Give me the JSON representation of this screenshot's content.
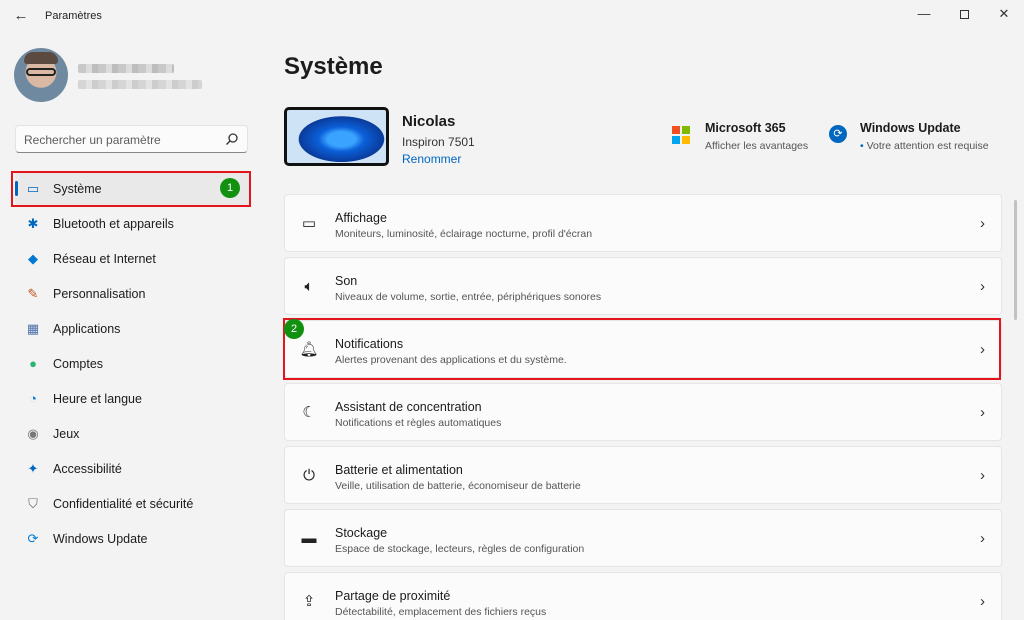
{
  "window": {
    "title": "Paramètres",
    "back_glyph": "←",
    "minimize_glyph": "—",
    "close_glyph": "✕"
  },
  "search": {
    "placeholder": "Rechercher un paramètre"
  },
  "sidebar": {
    "items": [
      {
        "label": "Système",
        "icon": "monitor-icon",
        "glyph": "▭",
        "color": "#0067c0",
        "active": true
      },
      {
        "label": "Bluetooth et appareils",
        "icon": "bluetooth-icon",
        "glyph": "✱",
        "color": "#0067c0"
      },
      {
        "label": "Réseau et Internet",
        "icon": "wifi-icon",
        "glyph": "◆",
        "color": "#0078d4"
      },
      {
        "label": "Personnalisation",
        "icon": "brush-icon",
        "glyph": "✎",
        "color": "#c24f1a"
      },
      {
        "label": "Applications",
        "icon": "apps-icon",
        "glyph": "▦",
        "color": "#4b6ea8"
      },
      {
        "label": "Comptes",
        "icon": "person-icon",
        "glyph": "●",
        "color": "#2bb673"
      },
      {
        "label": "Heure et langue",
        "icon": "globe-clock-icon",
        "glyph": "◔",
        "color": "#0078d4"
      },
      {
        "label": "Jeux",
        "icon": "gamepad-icon",
        "glyph": "◉",
        "color": "#777777"
      },
      {
        "label": "Accessibilité",
        "icon": "accessibility-icon",
        "glyph": "✦",
        "color": "#0067c0"
      },
      {
        "label": "Confidentialité et sécurité",
        "icon": "shield-icon",
        "glyph": "⛉",
        "color": "#6b6b6b"
      },
      {
        "label": "Windows Update",
        "icon": "windows-update-icon",
        "glyph": "⟳",
        "color": "#0078d4"
      }
    ]
  },
  "annotations": {
    "badge1": "1",
    "badge2": "2",
    "highlight_color": "#e2141c",
    "badge_color": "#12900f"
  },
  "main": {
    "title": "Système",
    "device": {
      "name": "Nicolas",
      "model": "Inspiron 7501",
      "rename": "Renommer"
    },
    "ms365": {
      "title": "Microsoft 365",
      "subtitle": "Afficher les avantages",
      "icon": "microsoft-logo-icon"
    },
    "windows_update": {
      "title": "Windows Update",
      "status": "Votre attention est requise",
      "status_glyph": "•",
      "icon": "windows-update-icon"
    },
    "cards": [
      {
        "title": "Affichage",
        "subtitle": "Moniteurs, luminosité, éclairage nocturne, profil d'écran",
        "icon": "display-icon",
        "glyph": "▭"
      },
      {
        "title": "Son",
        "subtitle": "Niveaux de volume, sortie, entrée, périphériques sonores",
        "icon": "speaker-icon",
        "glyph": "🔈︎"
      },
      {
        "title": "Notifications",
        "subtitle": "Alertes provenant des applications et du système.",
        "icon": "bell-icon",
        "glyph": "🔔︎"
      },
      {
        "title": "Assistant de concentration",
        "subtitle": "Notifications et règles automatiques",
        "icon": "moon-icon",
        "glyph": "☾"
      },
      {
        "title": "Batterie et alimentation",
        "subtitle": "Veille, utilisation de batterie, économiseur de batterie",
        "icon": "power-icon",
        "glyph": "⏻"
      },
      {
        "title": "Stockage",
        "subtitle": "Espace de stockage, lecteurs, règles de configuration",
        "icon": "storage-icon",
        "glyph": "▬"
      },
      {
        "title": "Partage de proximité",
        "subtitle": "Détectabilité, emplacement des fichiers reçus",
        "icon": "share-icon",
        "glyph": "⇪"
      }
    ],
    "chevron_glyph": "›"
  }
}
